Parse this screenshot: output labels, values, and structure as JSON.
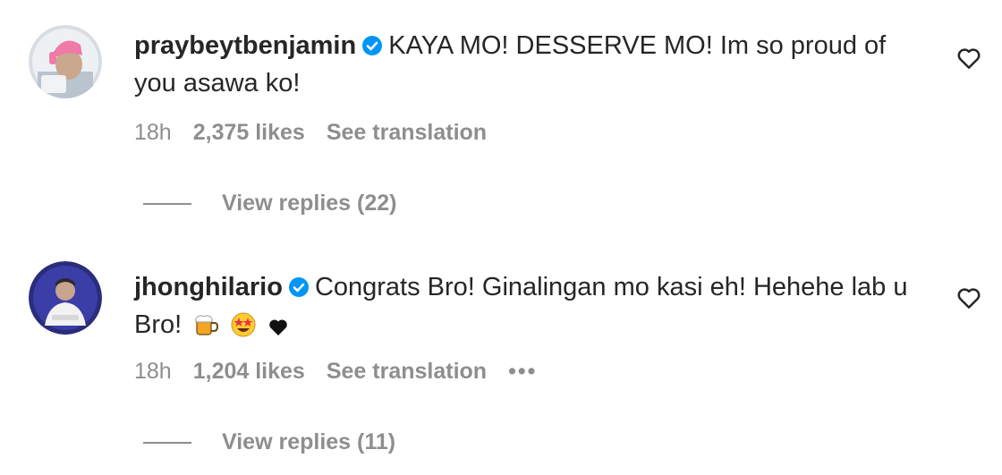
{
  "comments": [
    {
      "username": "praybeytbenjamin",
      "text": "KAYA MO! DESSERVE MO! Im so proud of you asawa ko!",
      "time": "18h",
      "likes": "2,375 likes",
      "translate": "See translation",
      "replies": "View replies (22)",
      "avatar_icon": "profile-avatar-pink-cap",
      "verified_color": "#0095f6"
    },
    {
      "username": "jhonghilario",
      "text": "Congrats Bro! Ginalingan mo kasi eh! Hehehe lab u Bro!",
      "emojis": [
        "beer-mug-emoji",
        "star-struck-emoji",
        "black-heart-emoji"
      ],
      "time": "18h",
      "likes": "1,204 likes",
      "translate": "See translation",
      "more": "•••",
      "replies": "View replies (11)",
      "avatar_icon": "profile-avatar-purple",
      "verified_color": "#0095f6"
    }
  ],
  "colors": {
    "text": "#262626",
    "muted": "#8e8e8e",
    "verified": "#0095f6"
  }
}
